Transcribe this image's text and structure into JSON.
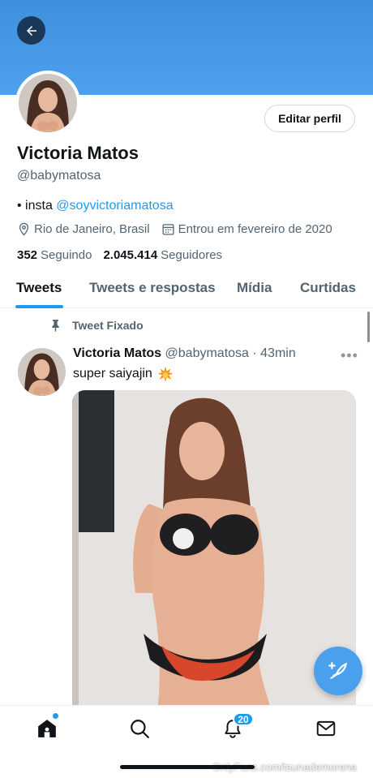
{
  "profile": {
    "name": "Victoria Matos",
    "handle": "@babymatosa",
    "bio_prefix": "• insta ",
    "bio_link": "@soyvictoriamatosa",
    "location": "Rio de Janeiro, Brasil",
    "joined": "Entrou em fevereiro de 2020",
    "following_count": "352",
    "following_label": "Seguindo",
    "followers_count": "2.045.414",
    "followers_label": "Seguidores",
    "edit_button": "Editar perfil"
  },
  "tabs": [
    {
      "label": "Tweets",
      "active": true
    },
    {
      "label": "Tweets e respostas",
      "active": false
    },
    {
      "label": "Mídia",
      "active": false
    },
    {
      "label": "Curtidas",
      "active": false
    }
  ],
  "tweet": {
    "pinned_label": "Tweet Fixado",
    "author_name": "Victoria Matos",
    "author_handle": "@babymatosa",
    "separator": " · ",
    "time": "43min",
    "text": "super saiyajin",
    "emoji_icon": "collision-icon"
  },
  "nav": {
    "items": [
      "home-icon",
      "search-icon",
      "notifications-icon",
      "messages-icon"
    ],
    "notification_badge": "20"
  },
  "watermark": "OnlyFans.com/tsunademorena",
  "colors": {
    "accent": "#1d9bf0",
    "banner": "#4a9ae8",
    "text_secondary": "#536471"
  }
}
